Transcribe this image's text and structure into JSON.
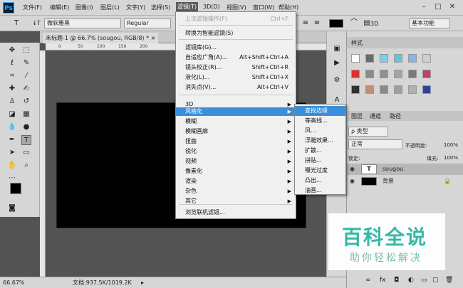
{
  "app": {
    "logo": "Ps"
  },
  "menubar": {
    "items": [
      "文件(F)",
      "编辑(E)",
      "图像(I)",
      "图层(L)",
      "文字(Y)",
      "选择(S)",
      "滤镜(T)",
      "3D(D)",
      "视图(V)",
      "窗口(W)",
      "帮助(H)"
    ],
    "active": "滤镜(T)",
    "window_controls": [
      "minimize-icon",
      "restore-icon",
      "close-icon"
    ]
  },
  "options_bar": {
    "font_family": "微软雅黑",
    "font_style": "Regular",
    "mode_3d": "3D",
    "workspace": "基本功能"
  },
  "document": {
    "tab_title": "未标题-1 @ 66.7% (sougou, RGB/8) *",
    "ruler_ticks": [
      "0",
      "50",
      "100",
      "150",
      "200"
    ],
    "zoom": "66.67%",
    "doc_size": "文档:937.5K/1019.2K"
  },
  "filter_menu": {
    "items": [
      {
        "label": "上次滤镜操作(F)",
        "shortcut": "Ctrl+F",
        "disabled": true
      },
      {
        "label": "转换为智能滤镜(S)"
      },
      {
        "label": "滤镜库(G)..."
      },
      {
        "label": "自适应广角(A)...",
        "shortcut": "Alt+Shift+Ctrl+A"
      },
      {
        "label": "镜头校正(R)...",
        "shortcut": "Shift+Ctrl+R"
      },
      {
        "label": "液化(L)...",
        "shortcut": "Shift+Ctrl+X"
      },
      {
        "label": "消失点(V)...",
        "shortcut": "Alt+Ctrl+V"
      },
      {
        "label": "3D",
        "submenu": true
      },
      {
        "label": "风格化",
        "submenu": true,
        "highlighted": true
      },
      {
        "label": "模糊",
        "submenu": true
      },
      {
        "label": "模糊画廊",
        "submenu": true
      },
      {
        "label": "扭曲",
        "submenu": true
      },
      {
        "label": "锐化",
        "submenu": true
      },
      {
        "label": "视频",
        "submenu": true
      },
      {
        "label": "像素化",
        "submenu": true
      },
      {
        "label": "渲染",
        "submenu": true
      },
      {
        "label": "杂色",
        "submenu": true
      },
      {
        "label": "其它",
        "submenu": true
      },
      {
        "label": "浏览联机滤镜..."
      }
    ]
  },
  "stylize_submenu": {
    "items": [
      "查找边缘",
      "等高线...",
      "风...",
      "浮雕效果...",
      "扩散...",
      "拼贴...",
      "曝光过度",
      "凸出...",
      "油画..."
    ],
    "highlighted": "查找边缘"
  },
  "panels": {
    "styles_tab": "样式",
    "layers_tabs": [
      "图层",
      "通道",
      "路径"
    ],
    "kind_filter": "ρ 类型",
    "blend_mode": "正常",
    "opacity_label": "不透明度:",
    "opacity_value": "100%",
    "lock_label": "锁定:",
    "fill_label": "填充:",
    "fill_value": "100%",
    "layers": [
      {
        "name": "sougou",
        "type": "text",
        "thumb": "T"
      },
      {
        "name": "背景",
        "type": "background",
        "locked": true
      }
    ],
    "swatch_colors": [
      "#ffffff",
      "#6a6a6a",
      "#7ad0ea",
      "#5fc6e6",
      "#7fb8e8",
      "#cfcfcf",
      "#e03030",
      "#8a8a8a",
      "#909090",
      "#a4a4a4",
      "#7a7a7a",
      "#c04060",
      "#303030",
      "#c09070",
      "#8a8a8a",
      "#a0a0a0",
      "#b0b0b0",
      "#3040a0"
    ]
  },
  "watermark": {
    "title": "百科全说",
    "subtitle": "助你轻松解决"
  },
  "colors": {
    "menu_highlight": "#3b8fd8",
    "watermark": "#35b8a6"
  }
}
